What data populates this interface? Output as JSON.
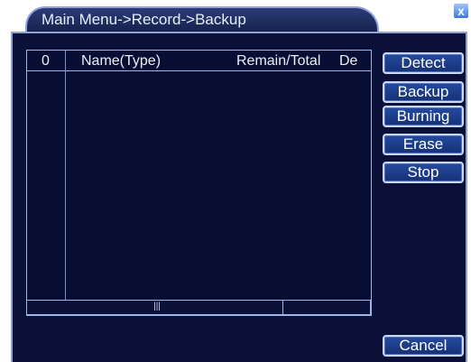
{
  "window": {
    "title": "Main Menu->Record->Backup",
    "close_label": "x"
  },
  "list": {
    "columns": [
      "0",
      "Name(Type)",
      "Remain/Total",
      "De"
    ]
  },
  "buttons": {
    "detect": "Detect",
    "backup": "Backup",
    "burning": "Burning",
    "erase": "Erase",
    "stop": "Stop",
    "cancel": "Cancel"
  },
  "scrollbar": {
    "thumb_glyph": "|||"
  }
}
